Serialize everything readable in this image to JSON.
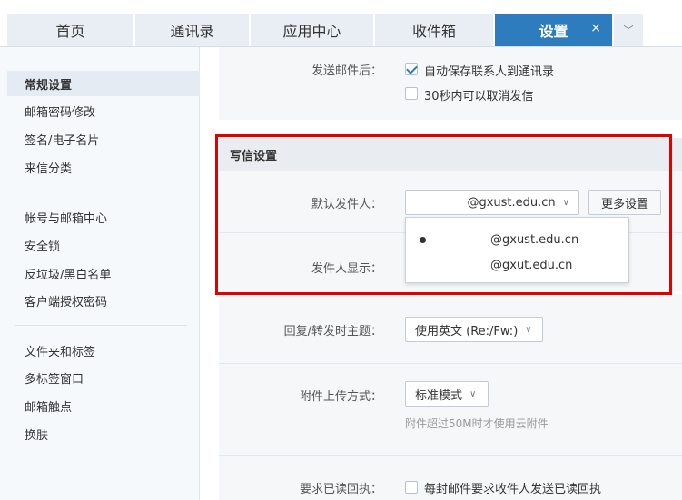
{
  "tabs": [
    {
      "label": "首页"
    },
    {
      "label": "通讯录"
    },
    {
      "label": "应用中心"
    },
    {
      "label": "收件箱"
    },
    {
      "label": "设置",
      "close": "×"
    }
  ],
  "sidebar": {
    "group1": [
      "常规设置",
      "邮箱密码修改",
      "签名/电子名片",
      "来信分类"
    ],
    "group2": [
      "帐号与邮箱中心",
      "安全锁",
      "反垃圾/黑白名单",
      "客户端授权密码"
    ],
    "group3": [
      "文件夹和标签",
      "多标签窗口",
      "邮箱触点",
      "换肤"
    ]
  },
  "after_send": {
    "label": "发送邮件后：",
    "opt1": "自动保存联系人到通讯录",
    "opt1_checked": true,
    "opt2": "30秒内可以取消发信",
    "opt2_checked": false
  },
  "compose": {
    "title": "写信设置",
    "default_sender_label": "默认发件人：",
    "default_sender_value": "@gxust.edu.cn",
    "more_settings": "更多设置",
    "sender_display_label": "发件人显示：",
    "popup_options": [
      "@gxust.edu.cn",
      "@gxut.edu.cn"
    ]
  },
  "reply": {
    "label": "回复/转发时主题：",
    "value": "使用英文 (Re:/Fw:)"
  },
  "attach": {
    "label": "附件上传方式：",
    "value": "标准模式",
    "hint": "附件超过50M时才使用云附件"
  },
  "receipt": {
    "label": "要求已读回执：",
    "option": "每封邮件要求收件人发送已读回执",
    "checked": false
  },
  "colors": {
    "accent": "#2d7dbe",
    "highlight": "#e00000"
  }
}
